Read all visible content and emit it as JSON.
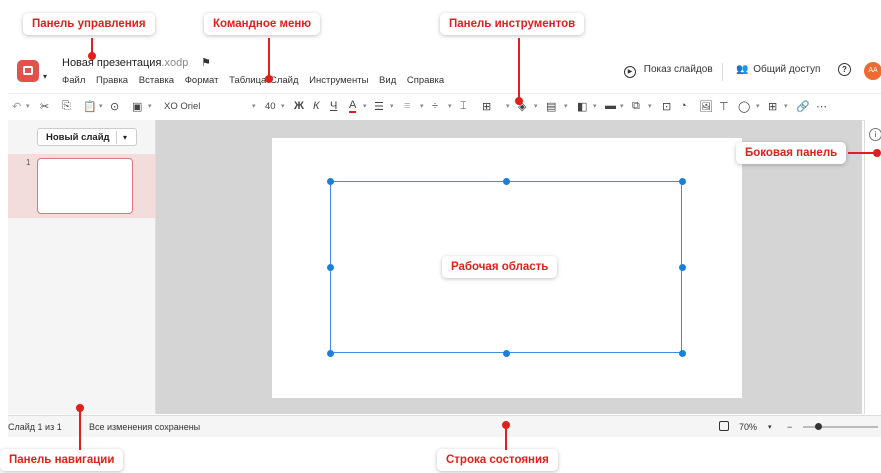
{
  "callouts": {
    "control_panel": "Панель управления",
    "command_menu": "Командное меню",
    "toolbar": "Панель инструментов",
    "sidebar": "Боковая панель",
    "workarea": "Рабочая область",
    "navigation": "Панель навигации",
    "statusbar": "Строка состояния"
  },
  "header": {
    "doc_name": "Новая презентация",
    "doc_ext": ".xodp",
    "menu": [
      "Файл",
      "Правка",
      "Вставка",
      "Формат",
      "Таблица",
      "Слайд",
      "Инструменты",
      "Вид",
      "Справка"
    ],
    "slideshow_label": "Показ слайдов",
    "share_label": "Общий доступ",
    "avatar_initials": "AA"
  },
  "toolbar": {
    "font_name": "XO Oriel",
    "font_size": "40",
    "bold": "Ж",
    "italic": "К",
    "underline": "Ч",
    "font_color": "A"
  },
  "nav": {
    "new_slide_label": "Новый слайд",
    "slide_number": "1"
  },
  "status": {
    "slide_counter": "Слайд 1 из 1",
    "save_state": "Все изменения сохранены",
    "zoom": "70%",
    "zoom_fraction": 0.2
  },
  "colors": {
    "accent_red": "#e0201b",
    "selection_blue": "#3d8fdc",
    "avatar_orange": "#f06a34"
  }
}
